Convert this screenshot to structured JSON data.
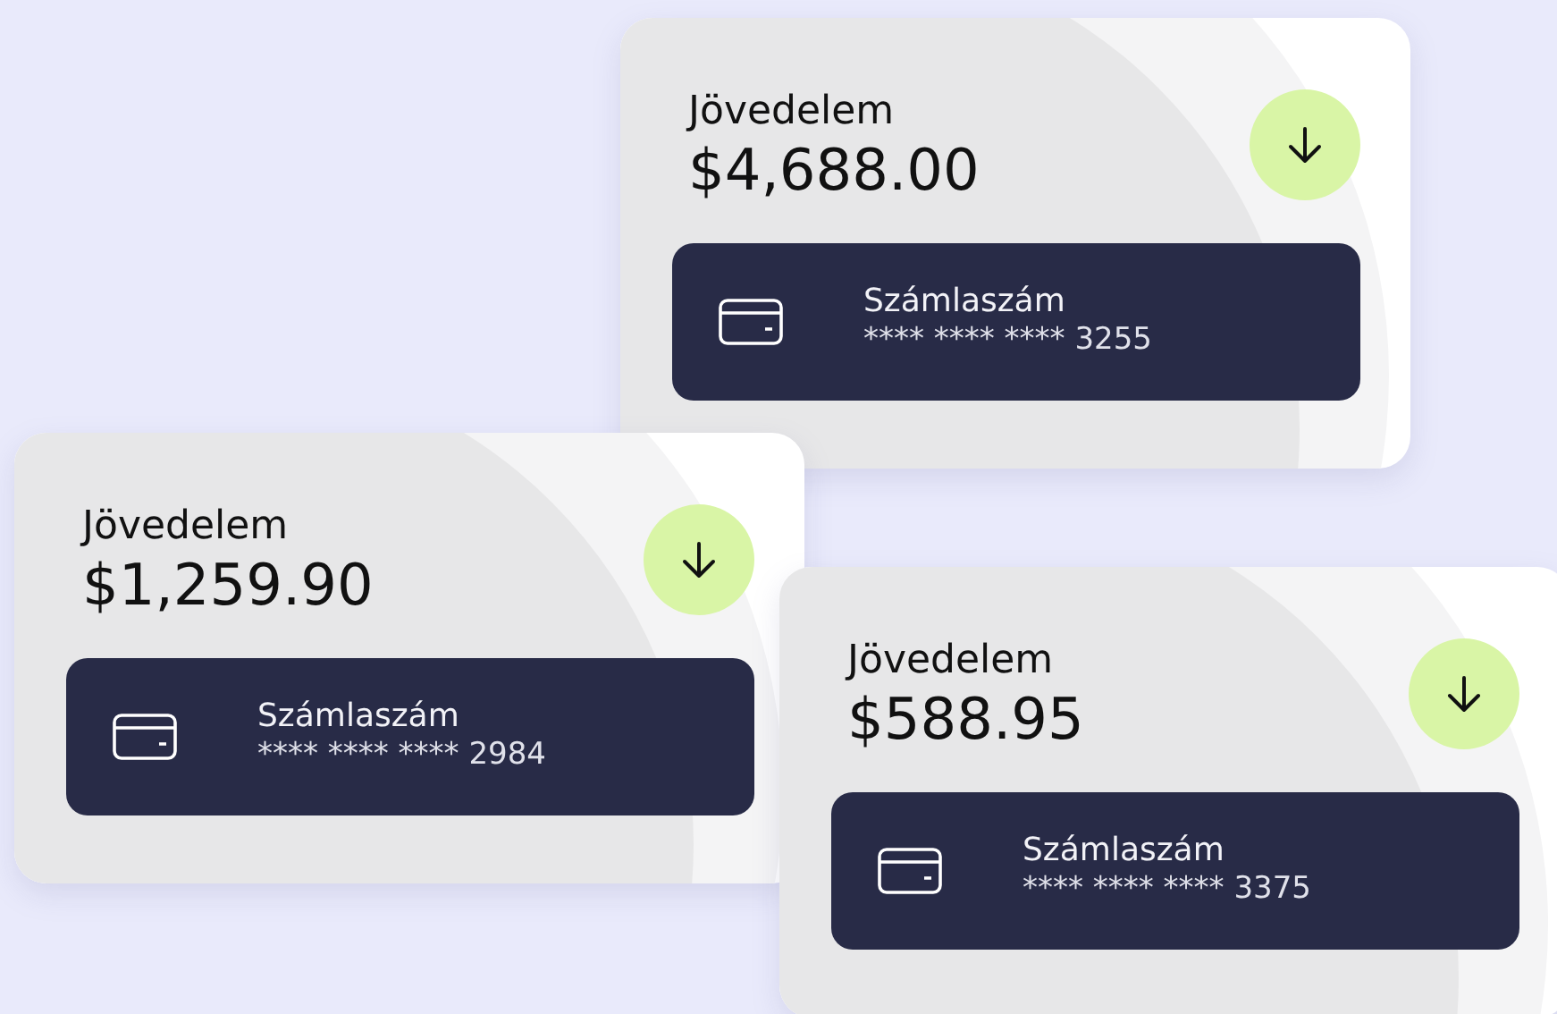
{
  "cards": [
    {
      "title": "Jövedelem",
      "amount": "$4,688.00",
      "account_label": "Számlaszám",
      "account_number": "**** **** **** 3255"
    },
    {
      "title": "Jövedelem",
      "amount": "$1,259.90",
      "account_label": "Számlaszám",
      "account_number": "**** **** **** 2984"
    },
    {
      "title": "Jövedelem",
      "amount": "$588.95",
      "account_label": "Számlaszám",
      "account_number": "**** **** **** 3375"
    }
  ]
}
